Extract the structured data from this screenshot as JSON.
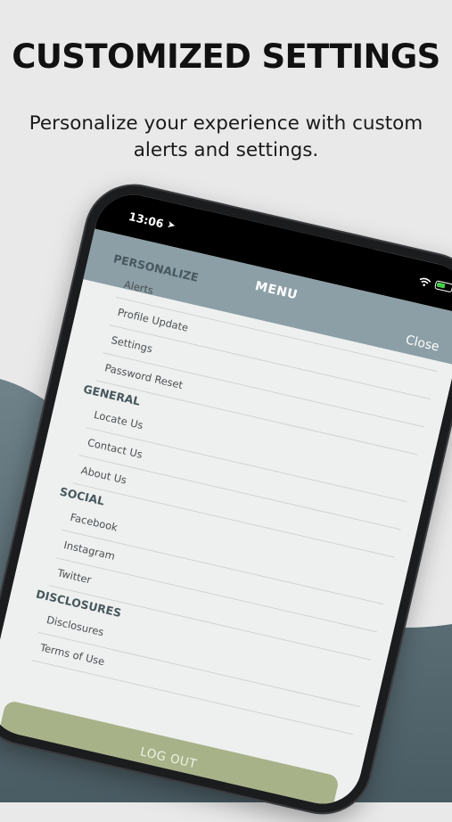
{
  "headline": "CUSTOMIZED SETTINGS",
  "subline": "Personalize your experience with custom alerts and settings.",
  "colors": {
    "background": "#e9e9e9",
    "wave": "#5b6e76",
    "header": "#8c9fa6",
    "logout": "#a8b289"
  },
  "status_bar": {
    "time": "13:06",
    "location_icon": "location-arrow-icon",
    "wifi_icon": "wifi-icon",
    "battery_icon": "battery-charging-icon"
  },
  "menu": {
    "title": "MENU",
    "close_label": "Close",
    "sections": [
      {
        "label": "PERSONALIZE",
        "items": [
          "Alerts",
          "Profile Update",
          "Settings",
          "Password Reset"
        ]
      },
      {
        "label": "GENERAL",
        "items": [
          "Locate Us",
          "Contact Us",
          "About Us"
        ]
      },
      {
        "label": "SOCIAL",
        "items": [
          "Facebook",
          "Instagram",
          "Twitter"
        ]
      },
      {
        "label": "DISCLOSURES",
        "items": [
          "Disclosures",
          "Terms of Use"
        ]
      }
    ],
    "logout_label": "LOG OUT"
  }
}
